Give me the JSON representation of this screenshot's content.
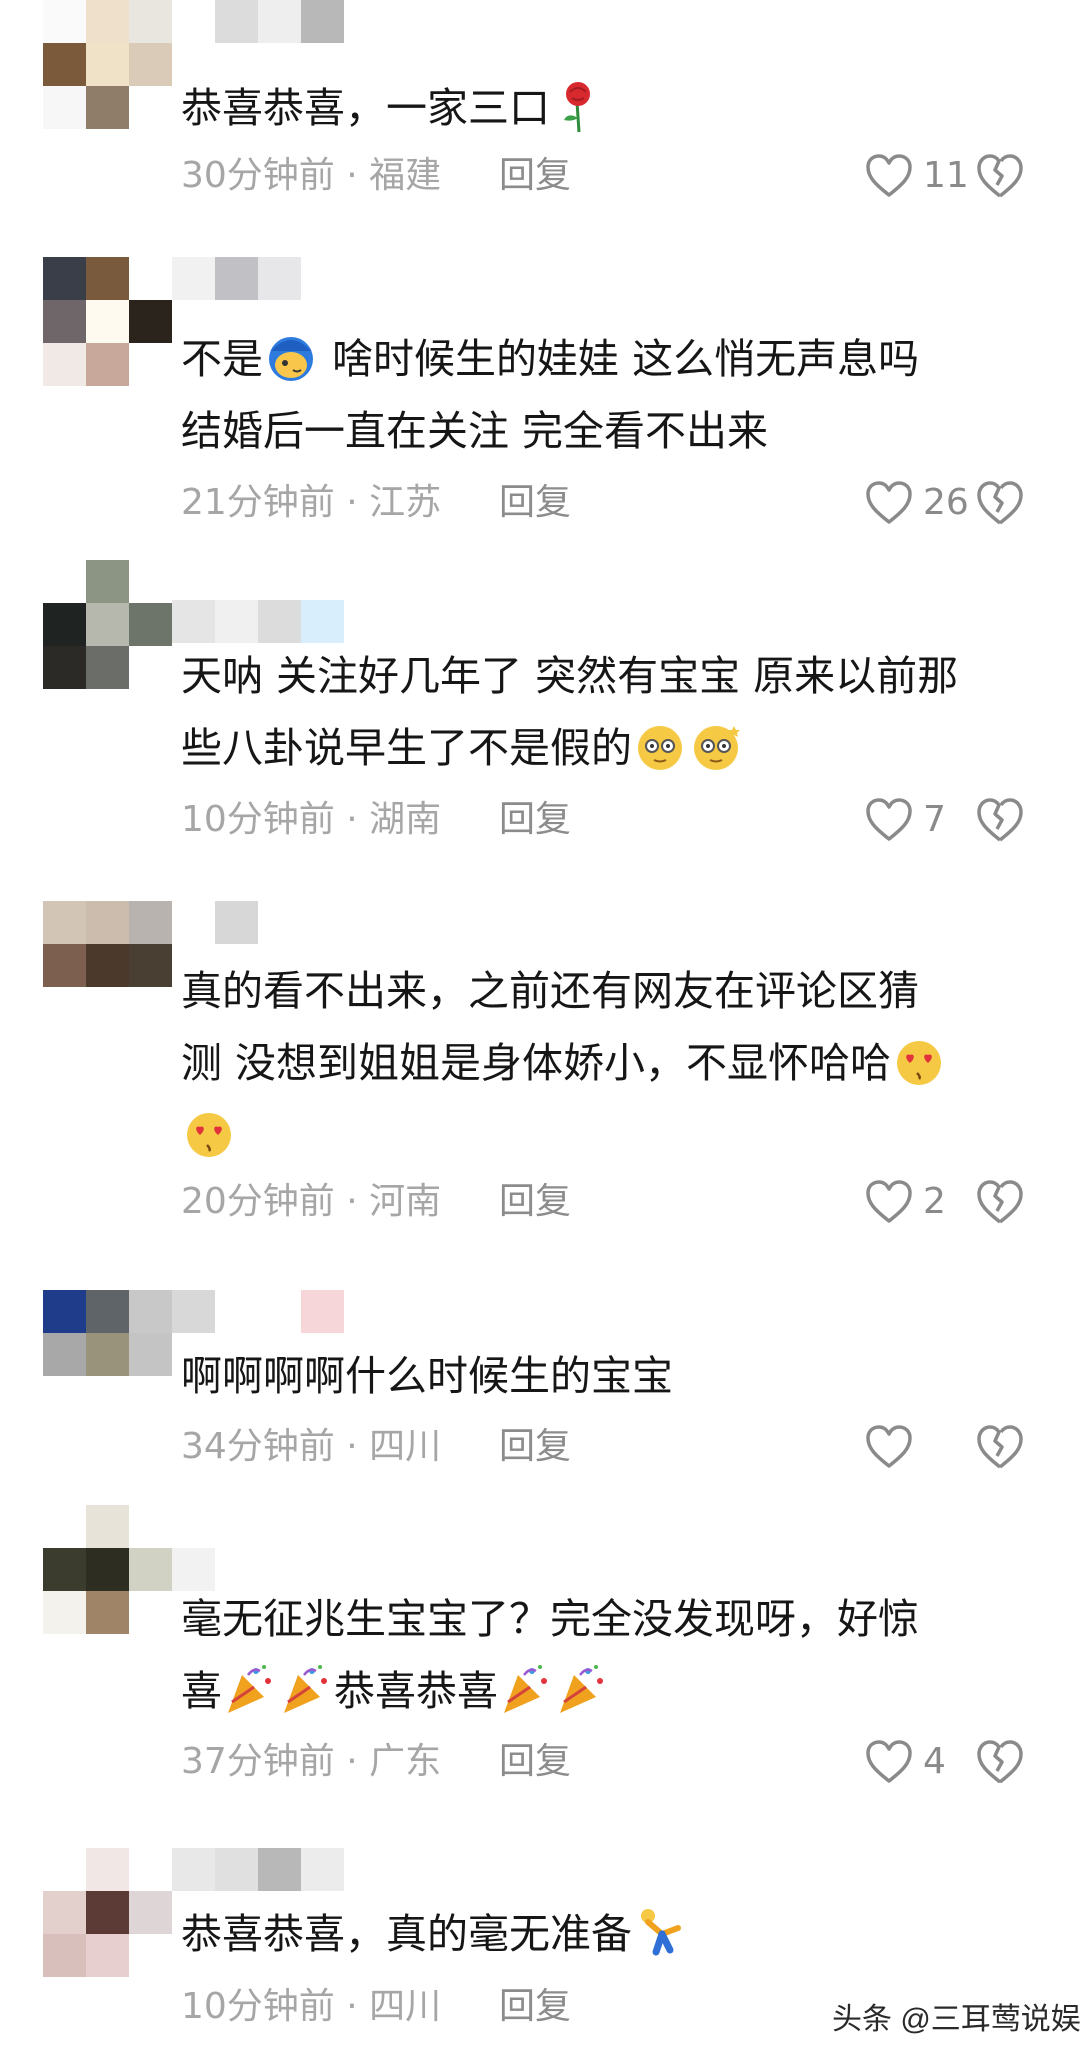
{
  "comments": [
    {
      "avatar": [
        "#fafafa",
        "#efe0cc",
        "#e9e6df",
        "#7b5a3c",
        "#efe2c6",
        "#d9cbb8",
        "#f7f7f7",
        "#8f7c69",
        "#ffffff"
      ],
      "name": [
        "#ffffff",
        "#dcdcdc",
        "#eeeeee",
        "#b8b8b8"
      ],
      "text": "恭喜恭喜，一家三口",
      "time": "30分钟前 · 福建",
      "reply": "回复",
      "likes": "11"
    },
    {
      "avatar": [
        "#3a3e49",
        "#7a5a3c",
        "#ffffff",
        "#6e6669",
        "#fffaf0",
        "#2b241d",
        "#f0e9e6",
        "#c7a89b",
        "#ffffff"
      ],
      "name": [
        "#f1f1f1",
        "#c1c1c5",
        "#e7e7e9"
      ],
      "text_parts": [
        "不是",
        "啥时候生的娃娃 这么悄无声息吗\n结婚后一直在关注 完全看不出来"
      ],
      "time": "21分钟前 · 江苏",
      "reply": "回复",
      "likes": "26"
    },
    {
      "avatar": [
        "#ffffff",
        "#8c9484",
        "#ffffff",
        "#1f2423",
        "#b6b8ae",
        "#6d756b",
        "#2b2a27",
        "#6b6e68",
        "#ffffff"
      ],
      "name": [
        "#e5e5e5",
        "#f0f0f0",
        "#dcdcdc",
        "#d8eefc"
      ],
      "text": "天呐 关注好几年了 突然有宝宝 原来以前那\n些八卦说早生了不是假的",
      "time": "10分钟前 · 湖南",
      "reply": "回复",
      "likes": "7"
    },
    {
      "avatar": [
        "#d3c5b6",
        "#cbbcae",
        "#b8b3ae",
        "#7c5f4f",
        "#4b3a2b",
        "#494033",
        "#ffffff",
        "#ffffff",
        "#ffffff"
      ],
      "name": [
        "#ffffff",
        "#d7d7d7"
      ],
      "text": "真的看不出来，之前还有网友在评论区猜\n测 没想到姐姐是身体娇小，不显怀哈哈",
      "time": "20分钟前 · 河南",
      "reply": "回复",
      "likes": "2"
    },
    {
      "avatar": [
        "#1e3c8a",
        "#5e6467",
        "#c8c8c8",
        "#a8a8a8",
        "#9a937c",
        "#c4c4c4",
        "#ffffff",
        "#ffffff",
        "#ffffff"
      ],
      "name": [
        "#d8d8d8",
        "#ffffff",
        "#ffffff",
        "#f6d6d8"
      ],
      "text": "啊啊啊啊什么时候生的宝宝",
      "time": "34分钟前 · 四川",
      "reply": "回复",
      "likes": ""
    },
    {
      "avatar": [
        "#ffffff",
        "#e7e3d8",
        "#ffffff",
        "#3b3b2e",
        "#2d2d22",
        "#d1d1c4",
        "#f4f2ec",
        "#a08468",
        "#ffffff"
      ],
      "name": [
        "#f2f2f2",
        "#ffffff",
        "#ffffff",
        "#ffffff"
      ],
      "text": "毫无征兆生宝宝了？完全没发现呀，好惊\n喜",
      "text_suffix": "恭喜恭喜",
      "time": "37分钟前 · 广东",
      "reply": "回复",
      "likes": "4"
    },
    {
      "avatar": [
        "#ffffff",
        "#f1e7e5",
        "#ffffff",
        "#e3cfcb",
        "#5c3a36",
        "#ded6d6",
        "#d8bfbc",
        "#e8cfcf",
        "#ffffff"
      ],
      "name": [
        "#e8e8e8",
        "#e0e0e0",
        "#b8b8b8",
        "#ececec"
      ],
      "text": "恭喜恭喜，真的毫无准备",
      "time": "10分钟前 · 四川",
      "reply": "回复",
      "likes": ""
    }
  ],
  "watermark": "头条 @三耳莺说娱"
}
